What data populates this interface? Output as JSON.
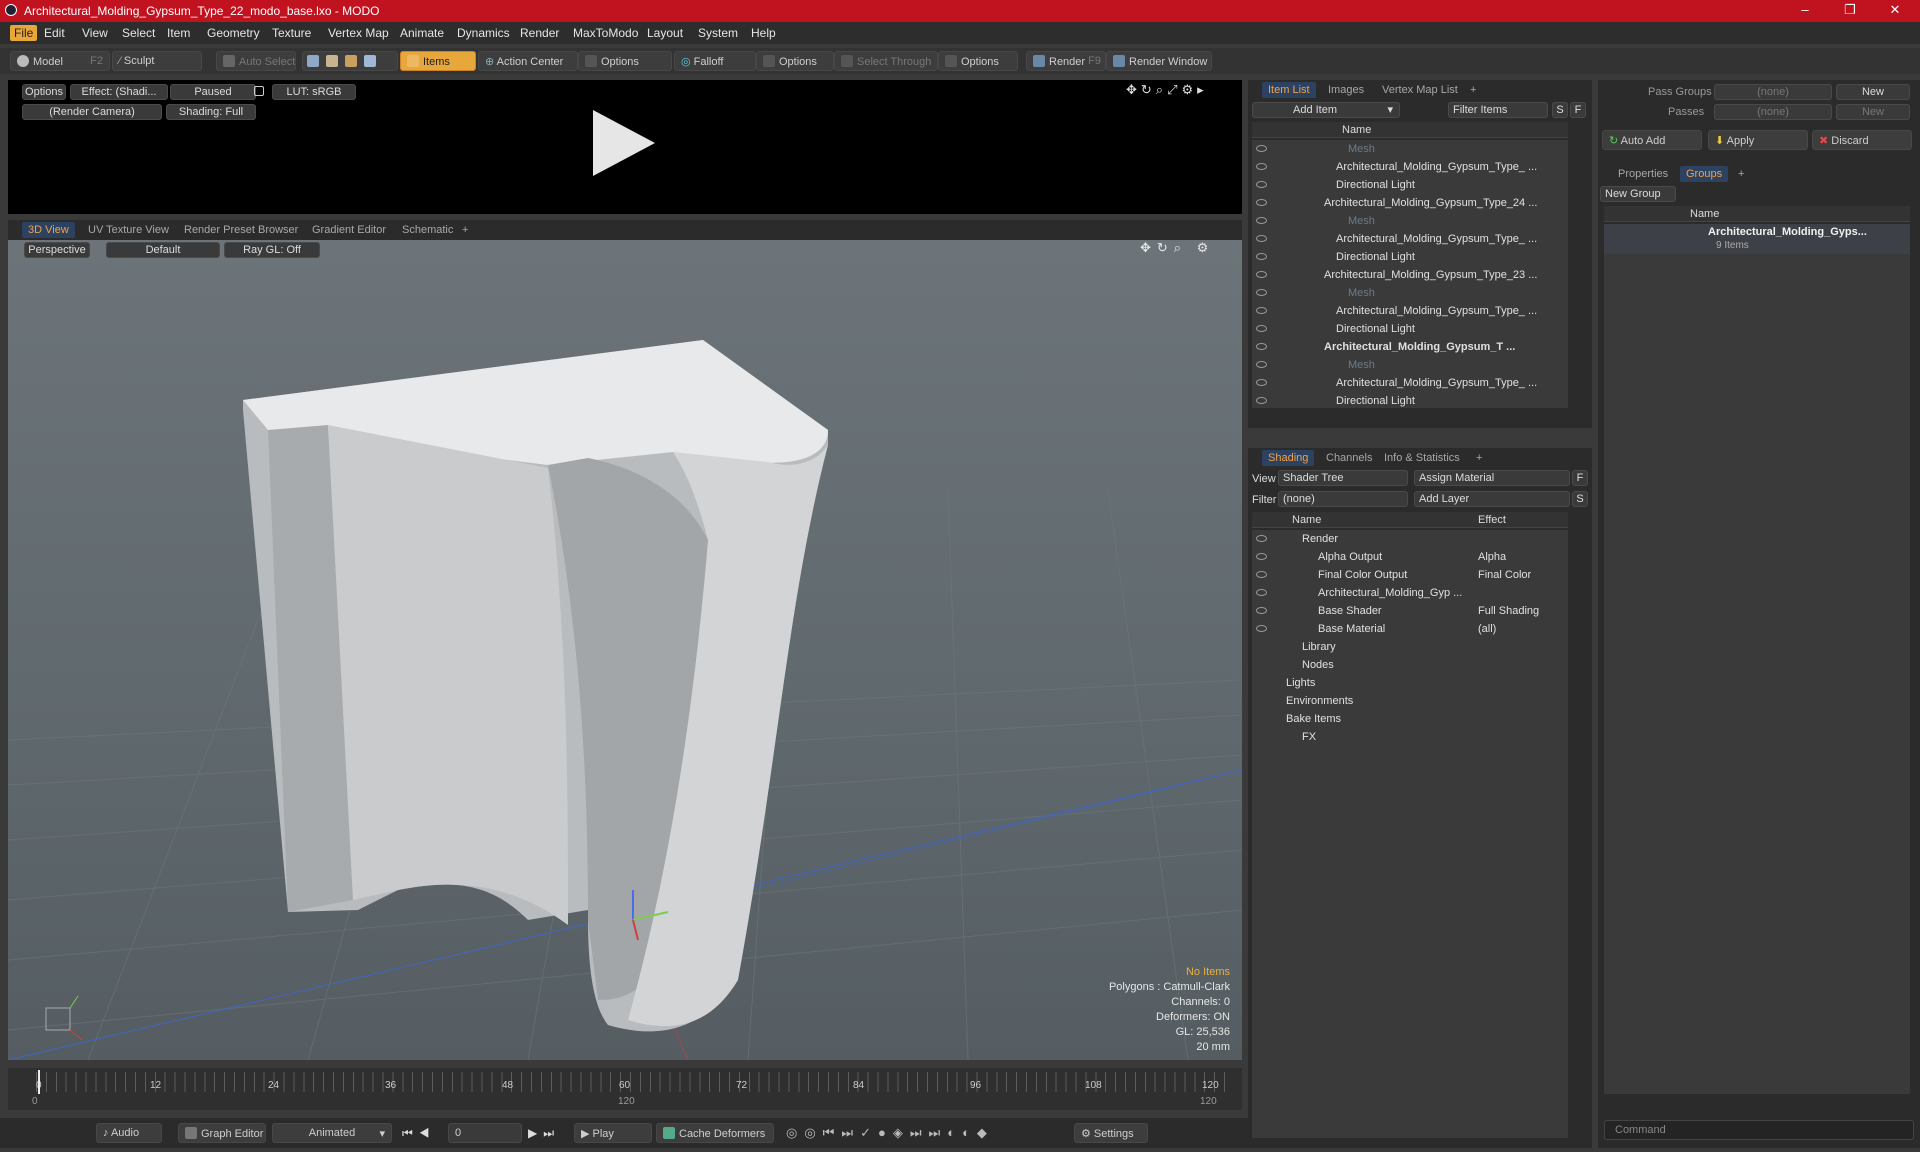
{
  "window": {
    "title": "Architectural_Molding_Gypsum_Type_22_modo_base.lxo - MODO",
    "minimize": "–",
    "maximize": "❐",
    "close": "✕"
  },
  "menu": [
    "File",
    "Edit",
    "View",
    "Select",
    "Item",
    "Geometry",
    "Texture",
    "Vertex Map",
    "Animate",
    "Dynamics",
    "Render",
    "MaxToModo",
    "Layout",
    "System",
    "Help"
  ],
  "toolbar": {
    "model": "Model",
    "model_key": "F2",
    "sculpt": "Sculpt",
    "auto_select": "Auto Select",
    "items": "Items",
    "action_center": "Action Center",
    "options1": "Options",
    "falloff": "Falloff",
    "options2": "Options",
    "select_through": "Select Through",
    "options3": "Options",
    "render": "Render",
    "render_key": "F9",
    "render_window": "Render Window"
  },
  "preview": {
    "options": "Options",
    "effect": "Effect: (Shadi...",
    "paused": "Paused",
    "lut": "LUT: sRGB",
    "camera": "(Render Camera)",
    "shading": "Shading: Full"
  },
  "viewport": {
    "tabs": [
      "3D View",
      "UV Texture View",
      "Render Preset Browser",
      "Gradient Editor",
      "Schematic"
    ],
    "perspective": "Perspective",
    "default": "Default",
    "raygl": "Ray GL: Off",
    "info": {
      "no_items": "No Items",
      "polygons": "Polygons : Catmull-Clark",
      "channels": "Channels: 0",
      "deformers": "Deformers: ON",
      "gl": "GL: 25,536",
      "unit": "20 mm"
    }
  },
  "timeline": {
    "ticks": [
      "0",
      "12",
      "24",
      "36",
      "48",
      "60",
      "72",
      "84",
      "96",
      "108",
      "120"
    ],
    "start": "0",
    "mid": "120",
    "end": "120"
  },
  "transport": {
    "audio": "Audio",
    "graph_editor": "Graph Editor",
    "animated": "Animated",
    "frame": "0",
    "play": "Play",
    "cache": "Cache Deformers",
    "settings": "Settings"
  },
  "item_list": {
    "tabs": [
      "Item List",
      "Images",
      "Vertex Map List"
    ],
    "add_item": "Add Item",
    "filter": "Filter Items",
    "s": "S",
    "f": "F",
    "col_name": "Name",
    "rows": [
      {
        "label": "Mesh",
        "indent": 3,
        "dim": true,
        "bold": false
      },
      {
        "label": "Architectural_Molding_Gypsum_Type_ ...",
        "indent": 2,
        "dim": false,
        "bold": false
      },
      {
        "label": "Directional Light",
        "indent": 2,
        "dim": false,
        "bold": false
      },
      {
        "label": "Architectural_Molding_Gypsum_Type_24 ...",
        "indent": 1,
        "dim": false,
        "bold": false
      },
      {
        "label": "Mesh",
        "indent": 3,
        "dim": true,
        "bold": false
      },
      {
        "label": "Architectural_Molding_Gypsum_Type_ ...",
        "indent": 2,
        "dim": false,
        "bold": false
      },
      {
        "label": "Directional Light",
        "indent": 2,
        "dim": false,
        "bold": false
      },
      {
        "label": "Architectural_Molding_Gypsum_Type_23 ...",
        "indent": 1,
        "dim": false,
        "bold": false
      },
      {
        "label": "Mesh",
        "indent": 3,
        "dim": true,
        "bold": false
      },
      {
        "label": "Architectural_Molding_Gypsum_Type_ ...",
        "indent": 2,
        "dim": false,
        "bold": false
      },
      {
        "label": "Directional Light",
        "indent": 2,
        "dim": false,
        "bold": false
      },
      {
        "label": "Architectural_Molding_Gypsum_T ...",
        "indent": 1,
        "dim": false,
        "bold": true
      },
      {
        "label": "Mesh",
        "indent": 3,
        "dim": true,
        "bold": false
      },
      {
        "label": "Architectural_Molding_Gypsum_Type_ ...",
        "indent": 2,
        "dim": false,
        "bold": false
      },
      {
        "label": "Directional Light",
        "indent": 2,
        "dim": false,
        "bold": false
      }
    ]
  },
  "shading": {
    "tabs": [
      "Shading",
      "Channels",
      "Info & Statistics"
    ],
    "view_label": "View",
    "view_value": "Shader Tree",
    "assign": "Assign Material",
    "f": "F",
    "filter_label": "Filter",
    "filter_value": "(none)",
    "add_layer": "Add Layer",
    "s": "S",
    "col_name": "Name",
    "col_effect": "Effect",
    "rows": [
      {
        "label": "Render",
        "effect": "",
        "indent": 0
      },
      {
        "label": "Alpha Output",
        "effect": "Alpha",
        "indent": 1
      },
      {
        "label": "Final Color Output",
        "effect": "Final Color",
        "indent": 1
      },
      {
        "label": "Architectural_Molding_Gyp ...",
        "effect": "",
        "indent": 1
      },
      {
        "label": "Base Shader",
        "effect": "Full Shading",
        "indent": 1
      },
      {
        "label": "Base Material",
        "effect": "(all)",
        "indent": 1
      },
      {
        "label": "Library",
        "effect": "",
        "indent": 0
      },
      {
        "label": "Nodes",
        "effect": "",
        "indent": 0
      },
      {
        "label": "Lights",
        "effect": "",
        "indent": -1
      },
      {
        "label": "Environments",
        "effect": "",
        "indent": -1
      },
      {
        "label": "Bake Items",
        "effect": "",
        "indent": -1
      },
      {
        "label": "FX",
        "effect": "",
        "indent": 0
      }
    ]
  },
  "groups": {
    "pass_groups": "Pass Groups",
    "pass_value": "(none)",
    "new1": "New",
    "passes": "Passes",
    "passes_value": "(none)",
    "new2": "New",
    "auto_add": "Auto Add",
    "apply": "Apply",
    "discard": "Discard",
    "tabs": [
      "Properties",
      "Groups"
    ],
    "new_group": "New Group",
    "col_name": "Name",
    "item_name": "Architectural_Molding_Gyps...",
    "item_count": "9 Items"
  },
  "command": {
    "placeholder": "Command"
  }
}
